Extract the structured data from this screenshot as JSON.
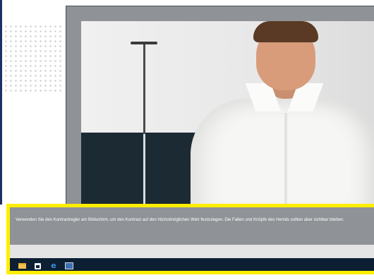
{
  "instruction": {
    "text": "Verwenden Sie den Kontrastregler am Bildschirm, um den Kontrast auf den höchstmöglichen Wert festzulegen. Die Falten und Knöpfe des Hemds sollten aber sichtbar bleiben."
  },
  "photo": {
    "subject": "man in white shirt contrast test image"
  },
  "taskbar": {
    "icons": [
      "file-explorer-icon",
      "store-icon",
      "edge-browser-icon",
      "display-calibration-icon"
    ],
    "edge_glyph": "e"
  },
  "colors": {
    "highlight": "#ffee00",
    "taskbar": "#0d1f33",
    "band": "#8f9296"
  }
}
